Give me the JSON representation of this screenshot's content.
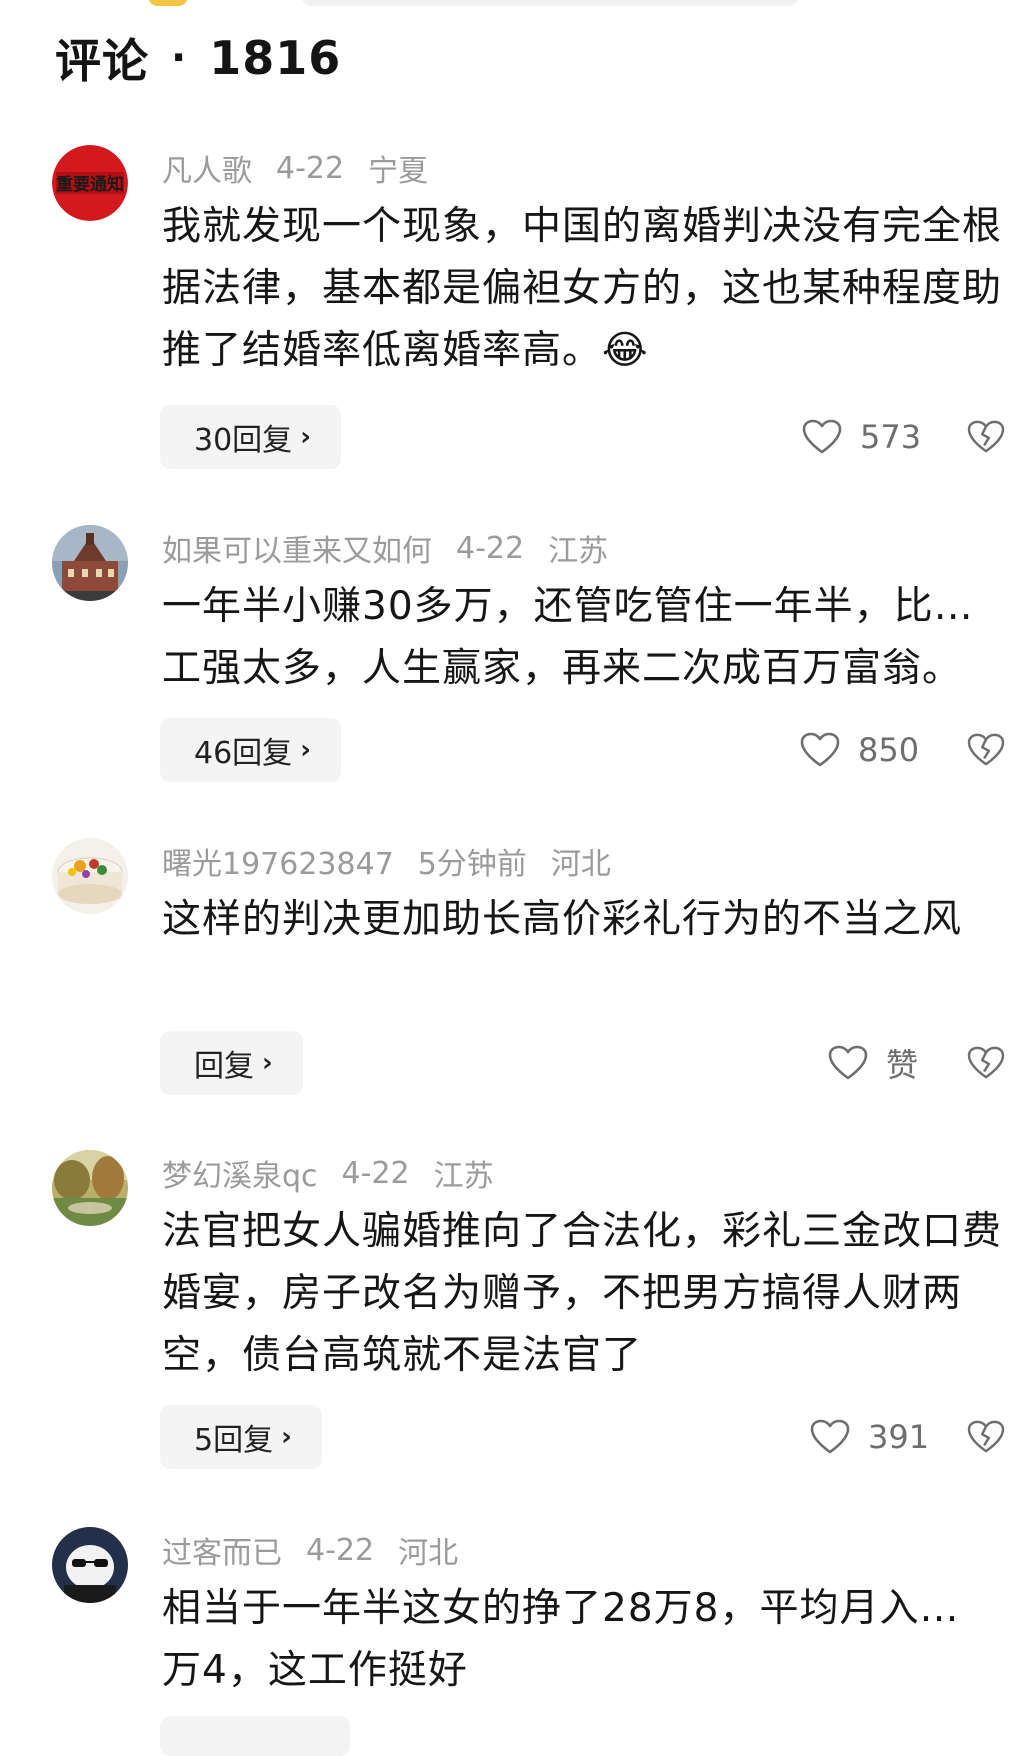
{
  "header": {
    "title": "评论",
    "separator": "·",
    "count": "1816"
  },
  "comments": [
    {
      "avatar": "red-notice-avatar",
      "avatar_text": "重要通知",
      "user": "凡人歌",
      "date": "4-22",
      "location": "宁夏",
      "text": "我就发现一个现象，中国的离婚判决没有完全根据法律，基本都是偏袒女方的，这也某种程度助推了结婚率低离婚率高。😂",
      "reply_label": "30回复",
      "likes": "573"
    },
    {
      "avatar": "building-avatar",
      "user": "如果可以重来又如何",
      "date": "4-22",
      "location": "江苏",
      "text_line1": "一年半小赚30多万，还管吃管住一年半，比…",
      "text_line2": "工强太多，人生赢家，再来二次成百万富翁。",
      "reply_label": "46回复",
      "likes": "850"
    },
    {
      "avatar": "cake-avatar",
      "user": "曙光197623847",
      "date": "5分钟前",
      "location": "河北",
      "text": "这样的判决更加助长高价彩礼行为的不当之风",
      "reply_label": "回复",
      "likes": "赞"
    },
    {
      "avatar": "landscape-avatar",
      "user": "梦幻溪泉qc",
      "date": "4-22",
      "location": "江苏",
      "text": "法官把女人骗婚推向了合法化，彩礼三金改口费婚宴，房子改名为赠予，不把男方搞得人财两空，债台高筑就不是法官了",
      "reply_label": "5回复",
      "likes": "391"
    },
    {
      "avatar": "sunglasses-avatar",
      "user": "过客而已",
      "date": "4-22",
      "location": "河北",
      "text_line1": "相当于一年半这女的挣了28万8，平均月入…",
      "text_line2": "万4，这工作挺好"
    }
  ],
  "icons": {
    "chevron": "›",
    "like": "heart-outline-icon",
    "dislike": "broken-heart-icon"
  },
  "colors": {
    "meta_text": "#9b9b9b",
    "reply_bg": "#f4f4f5",
    "icon_gray": "#6e6e6e"
  }
}
